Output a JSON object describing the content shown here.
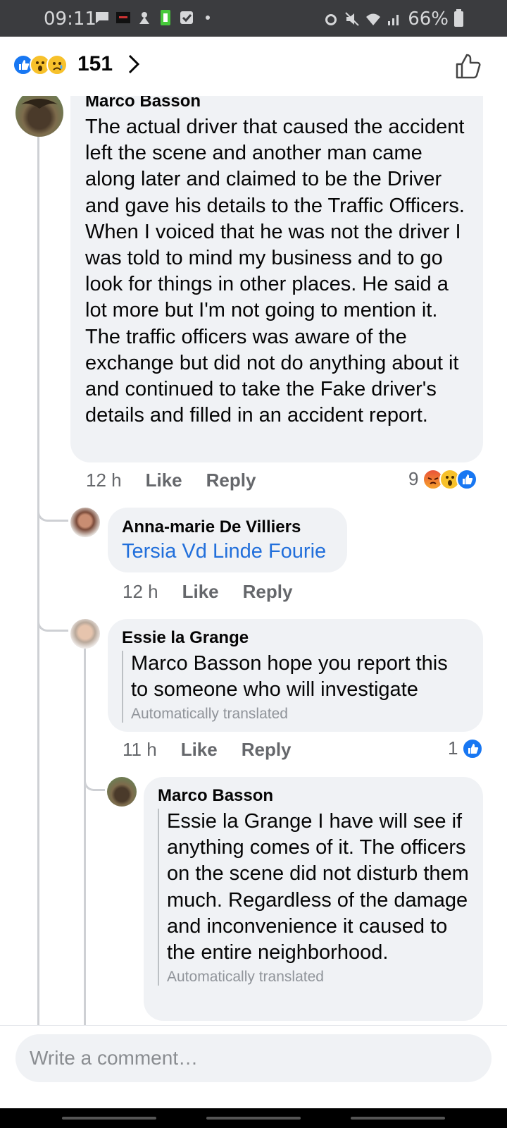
{
  "status_bar": {
    "time": "09:11",
    "battery": "66%"
  },
  "reactions_bar": {
    "count": "151",
    "emojis": [
      "like",
      "wow",
      "sad"
    ]
  },
  "comments": [
    {
      "author": "Marco Basson",
      "text": "The actual driver that caused the accident left the scene and another man came along later and claimed to be the Driver and gave his details to the Traffic Officers. When I voiced that he was not the driver I was told to mind my business and to go look for things in other places. He said a lot more but I'm not going to mention it.  The traffic officers was aware of the exchange but did not do anything about it and continued to take the Fake driver's details and filled in an accident report.",
      "time": "12 h",
      "like_label": "Like",
      "reply_label": "Reply",
      "reaction_count": "9",
      "reaction_emojis": [
        "angry",
        "wow",
        "like"
      ]
    },
    {
      "author": "Anna-marie De Villiers",
      "tag": "Tersia Vd Linde Fourie",
      "time": "12 h",
      "like_label": "Like",
      "reply_label": "Reply"
    },
    {
      "author": "Essie la Grange",
      "text": "Marco Basson hope you report this to someone who will investigate",
      "translated_note": "Automatically translated",
      "time": "11 h",
      "like_label": "Like",
      "reply_label": "Reply",
      "reaction_count": "1",
      "reaction_emojis": [
        "like"
      ]
    },
    {
      "author": "Marco Basson",
      "text": "Essie la Grange I have will see if anything comes of it. The officers on the scene did not disturb them much. Regardless of the damage and inconvenience it caused to the entire neighborhood.",
      "translated_note": "Automatically translated"
    }
  ],
  "composer": {
    "placeholder": "Write a comment…"
  },
  "colors": {
    "status_bar_bg": "#3b3c3f",
    "bubble_bg": "#f0f2f5",
    "link_blue": "#216fdb",
    "like_blue": "#1877f2"
  }
}
